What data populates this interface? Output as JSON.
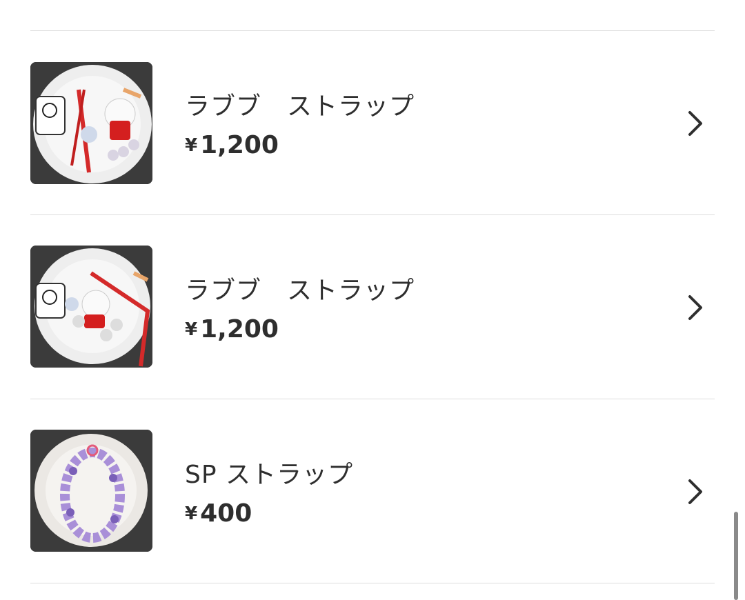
{
  "items": [
    {
      "title": "ラブブ　ストラップ",
      "currency": "¥",
      "price": "1,200",
      "image_icon": "labubu-strap-photo"
    },
    {
      "title": "ラブブ　ストラップ",
      "currency": "¥",
      "price": "1,200",
      "image_icon": "labubu-strap-photo"
    },
    {
      "title": "SP ストラップ",
      "currency": "¥",
      "price": "400",
      "image_icon": "bead-strap-photo"
    }
  ],
  "chevron_icon": "chevron-right-icon",
  "colors": {
    "text": "#2e2e2e",
    "divider": "#dcdcdc",
    "scrollbar": "#8a8a8a"
  }
}
